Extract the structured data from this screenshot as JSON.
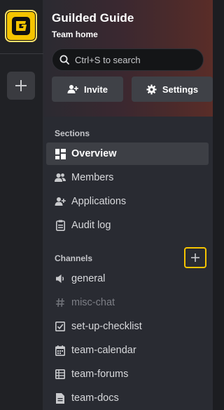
{
  "team": {
    "name": "Guilded Guide",
    "subtitle": "Team home"
  },
  "search": {
    "placeholder": "Ctrl+S to search"
  },
  "actions": {
    "invite_label": "Invite",
    "settings_label": "Settings"
  },
  "sections": {
    "header": "Sections",
    "items": [
      {
        "label": "Overview",
        "icon": "overview-grid-icon",
        "active": true
      },
      {
        "label": "Members",
        "icon": "members-icon"
      },
      {
        "label": "Applications",
        "icon": "applications-icon"
      },
      {
        "label": "Audit log",
        "icon": "audit-log-icon"
      }
    ]
  },
  "channels": {
    "header": "Channels",
    "items": [
      {
        "label": "general",
        "icon": "speaker-icon"
      },
      {
        "label": "misc-chat",
        "icon": "hash-icon",
        "muted": true
      },
      {
        "label": "set-up-checklist",
        "icon": "checklist-icon"
      },
      {
        "label": "team-calendar",
        "icon": "calendar-icon"
      },
      {
        "label": "team-forums",
        "icon": "forums-icon"
      },
      {
        "label": "team-docs",
        "icon": "docs-icon"
      }
    ]
  },
  "colors": {
    "accent": "#f5c400",
    "rail": "#202125",
    "panel": "#292b32"
  }
}
